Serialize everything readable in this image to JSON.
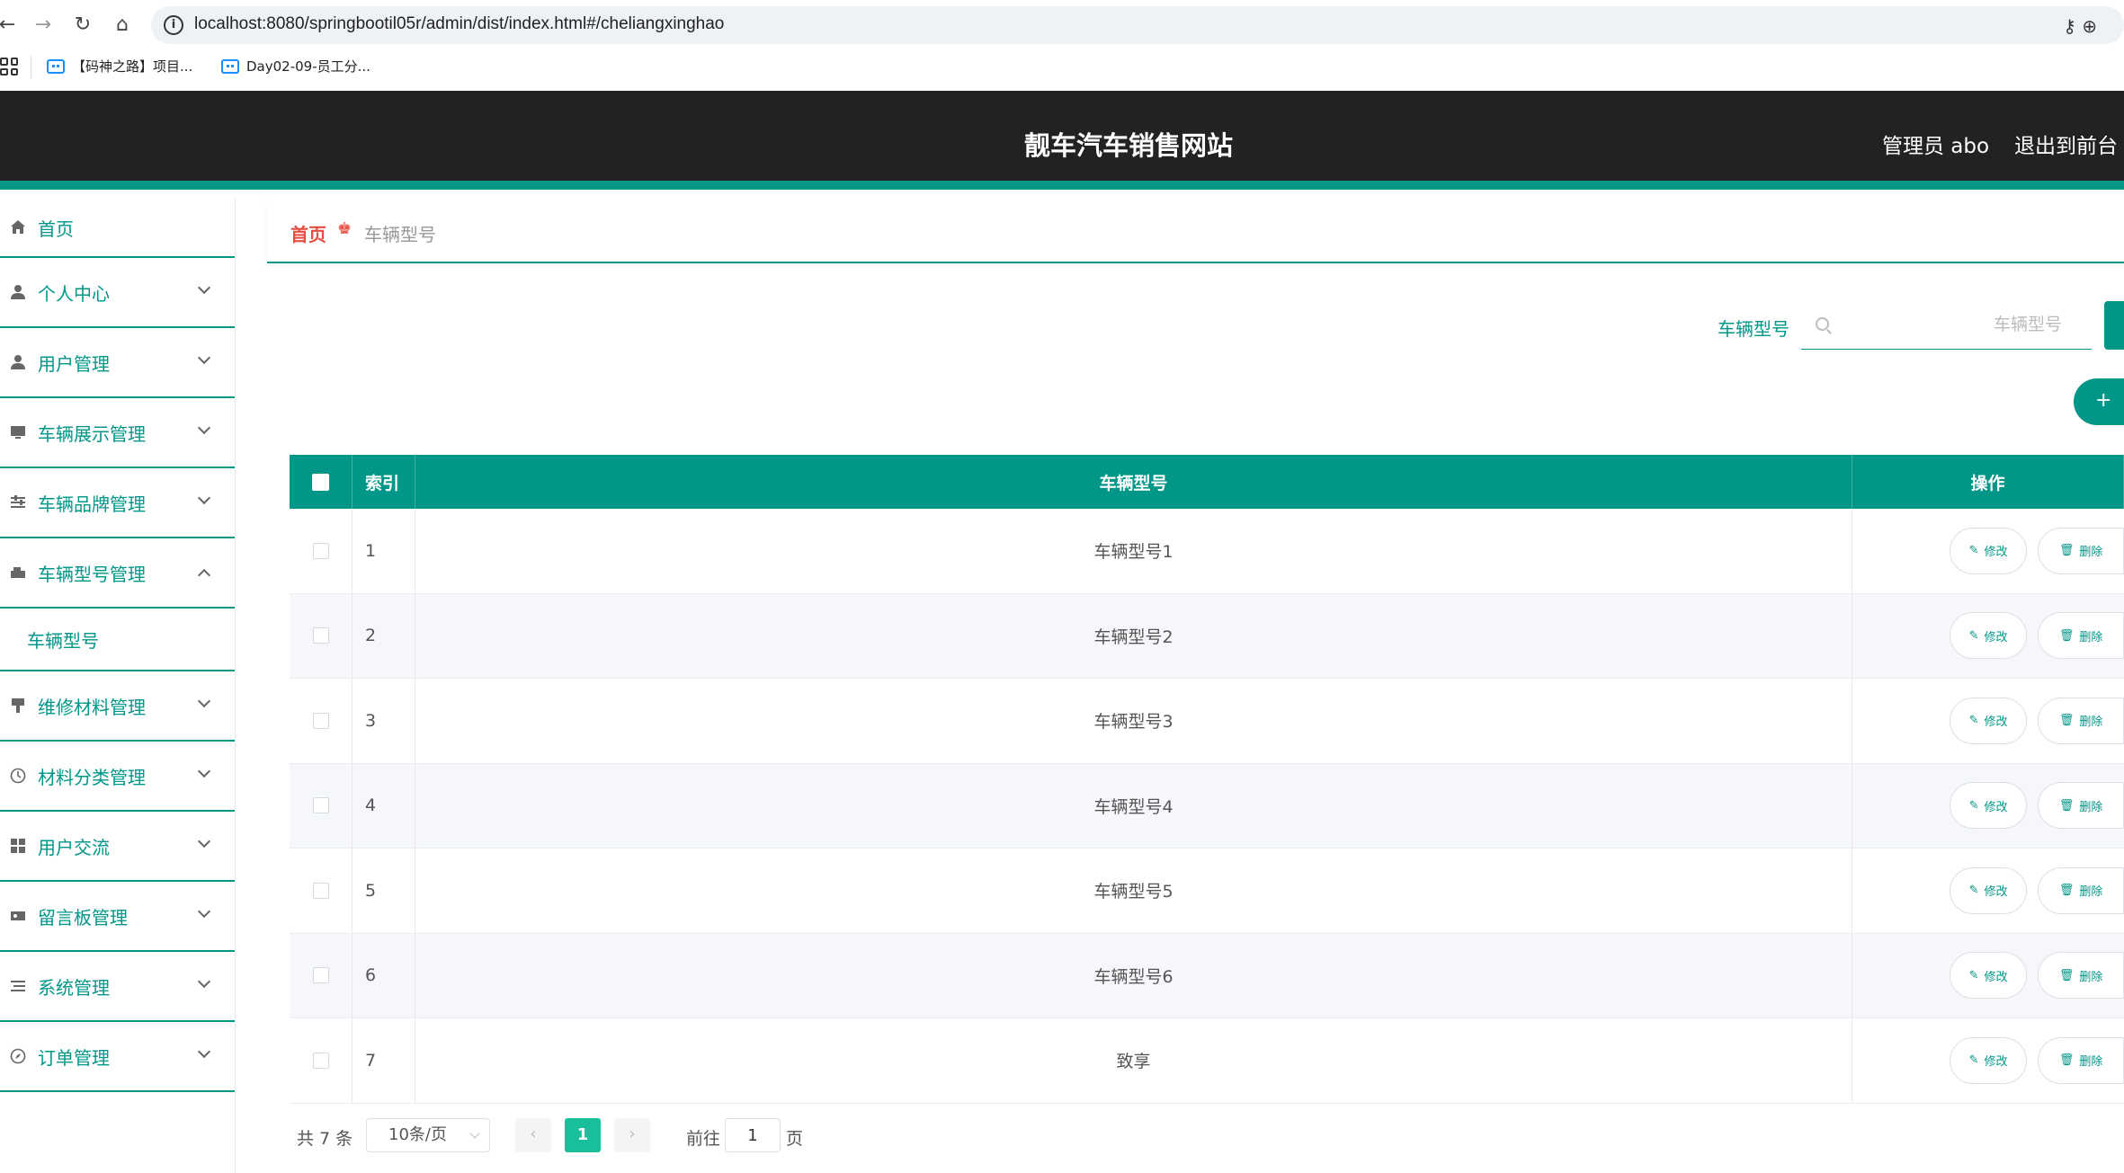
{
  "browser": {
    "url": "localhost:8080/springbootil05r/admin/dist/index.html#/cheliangxinghao",
    "bookmarks": [
      "【码神之路】项目...",
      "Day02-09-员工分..."
    ]
  },
  "header": {
    "title": "靓车汽车销售网站",
    "user": "管理员 abo",
    "logout": "退出到前台"
  },
  "sidebar": {
    "items": [
      {
        "label": "首页",
        "icon": "home-icon"
      },
      {
        "label": "个人中心",
        "icon": "user-icon"
      },
      {
        "label": "用户管理",
        "icon": "user-icon"
      },
      {
        "label": "车辆展示管理",
        "icon": "monitor-icon"
      },
      {
        "label": "车辆品牌管理",
        "icon": "sliders-icon"
      },
      {
        "label": "车辆型号管理",
        "icon": "car-icon",
        "expanded": true
      },
      {
        "label": "维修材料管理",
        "icon": "brush-icon"
      },
      {
        "label": "材料分类管理",
        "icon": "clock-icon"
      },
      {
        "label": "用户交流",
        "icon": "grid-icon"
      },
      {
        "label": "留言板管理",
        "icon": "ticket-icon"
      },
      {
        "label": "系统管理",
        "icon": "list-icon"
      },
      {
        "label": "订单管理",
        "icon": "compass-icon"
      }
    ],
    "submenu": "车辆型号"
  },
  "breadcrumb": {
    "home": "首页",
    "current": "车辆型号"
  },
  "search": {
    "label": "车辆型号",
    "placeholder": "车辆型号"
  },
  "add_button": "+",
  "table": {
    "headers": {
      "index": "索引",
      "name": "车辆型号",
      "ops": "操作"
    },
    "edit_label": "修改",
    "delete_label": "删除",
    "rows": [
      {
        "index": "1",
        "name": "车辆型号1"
      },
      {
        "index": "2",
        "name": "车辆型号2"
      },
      {
        "index": "3",
        "name": "车辆型号3"
      },
      {
        "index": "4",
        "name": "车辆型号4"
      },
      {
        "index": "5",
        "name": "车辆型号5"
      },
      {
        "index": "6",
        "name": "车辆型号6"
      },
      {
        "index": "7",
        "name": "致享"
      }
    ]
  },
  "pagination": {
    "total": "共 7 条",
    "page_size": "10条/页",
    "current_page": "1",
    "goto_label": "前往",
    "goto_value": "1",
    "page_suffix": "页"
  },
  "colors": {
    "accent": "#009688",
    "header_bg": "#222222",
    "breadcrumb_home": "#e54d42",
    "pager_active": "#19be9b"
  }
}
